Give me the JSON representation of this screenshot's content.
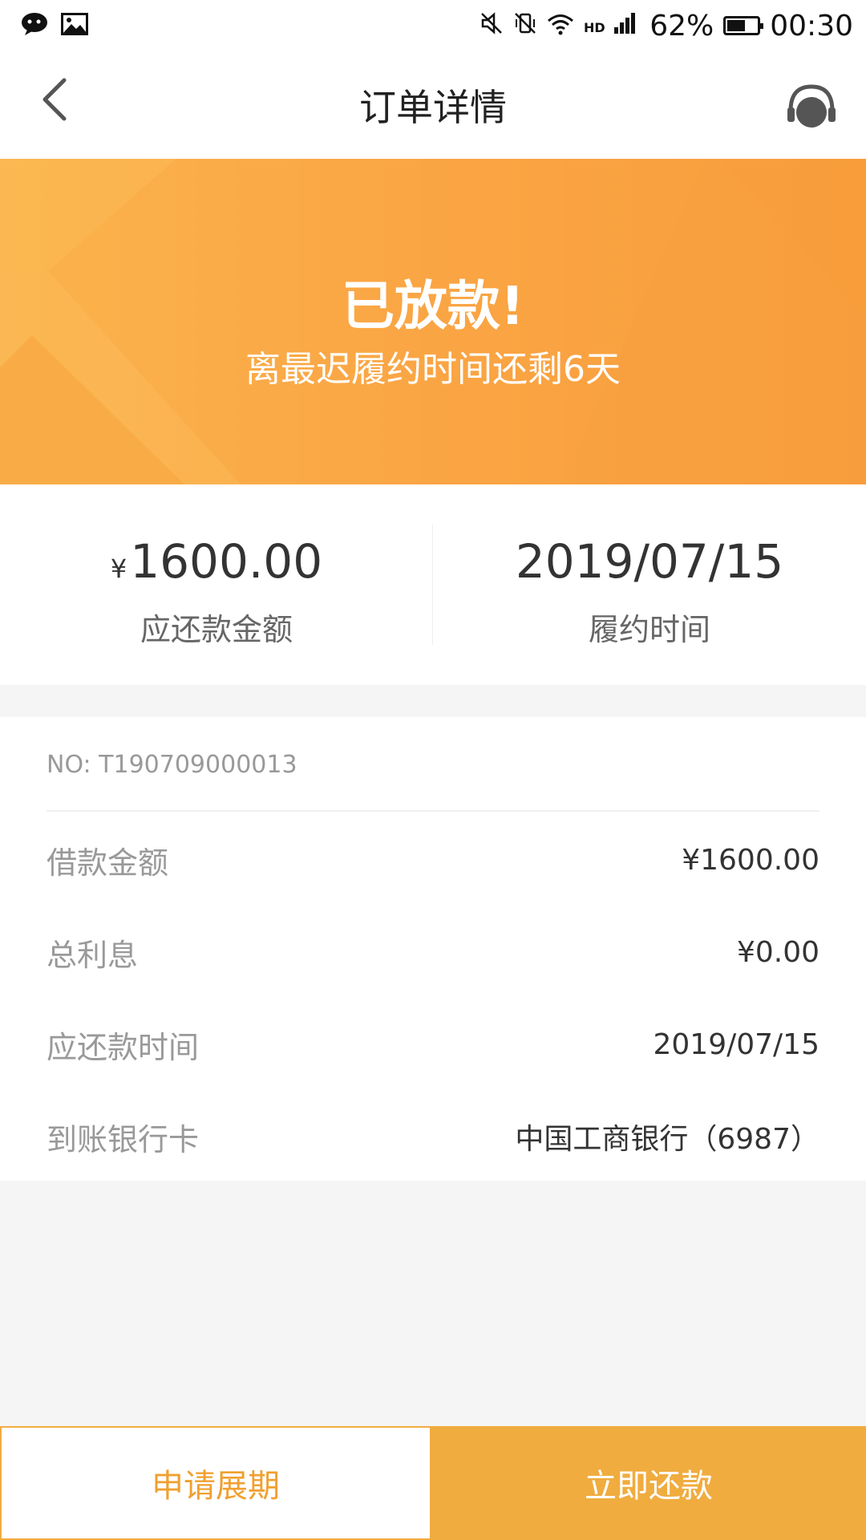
{
  "status_bar": {
    "battery_percent": "62%",
    "battery_level": 0.62,
    "time": "00:30",
    "icons": [
      "wechat-icon",
      "image-icon",
      "mute-icon",
      "vibrate-off-icon",
      "wifi-icon",
      "hd-signal-icon"
    ]
  },
  "header": {
    "title": "订单详情",
    "back_icon": "chevron-left-icon",
    "service_icon": "headset-icon"
  },
  "banner": {
    "title": "已放款!",
    "subtitle": "离最迟履约时间还剩6天",
    "color": "#faa544"
  },
  "summary": {
    "amount_currency": "¥",
    "amount_value": "1600.00",
    "amount_label": "应还款金额",
    "date_value": "2019/07/15",
    "date_label": "履约时间"
  },
  "details": {
    "order_no": "NO: T190709000013",
    "rows": [
      {
        "label": "借款金额",
        "value": "¥1600.00"
      },
      {
        "label": "总利息",
        "value": "¥0.00"
      },
      {
        "label": "应还款时间",
        "value": "2019/07/15"
      },
      {
        "label": "到账银行卡",
        "value": "中国工商银行（6987）"
      }
    ]
  },
  "actions": {
    "extend_label": "申请展期",
    "repay_label": "立即还款",
    "accent_color": "#f0ac3f"
  }
}
